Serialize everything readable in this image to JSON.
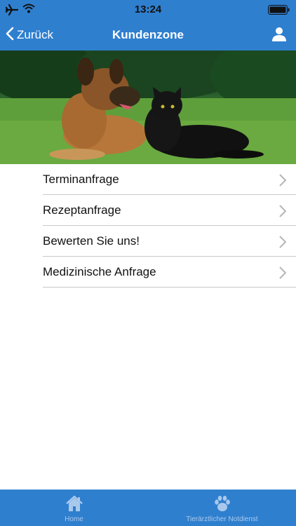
{
  "status_bar": {
    "time": "13:24"
  },
  "nav": {
    "back_label": "Zurück",
    "title": "Kundenzone",
    "profile_icon": "person-icon"
  },
  "hero": {
    "description_icon": "dog-and-cat-photo"
  },
  "menu": {
    "items": [
      {
        "label": "Terminanfrage"
      },
      {
        "label": "Rezeptanfrage"
      },
      {
        "label": "Bewerten Sie uns!"
      },
      {
        "label": "Medizinische Anfrage"
      }
    ]
  },
  "tabs": [
    {
      "label": "Home",
      "icon": "home-icon"
    },
    {
      "label": "Tierärztlicher Notdienst",
      "icon": "paw-icon"
    }
  ],
  "colors": {
    "brand": "#2f7fcf",
    "tab_inactive": "#a9c9ec"
  }
}
